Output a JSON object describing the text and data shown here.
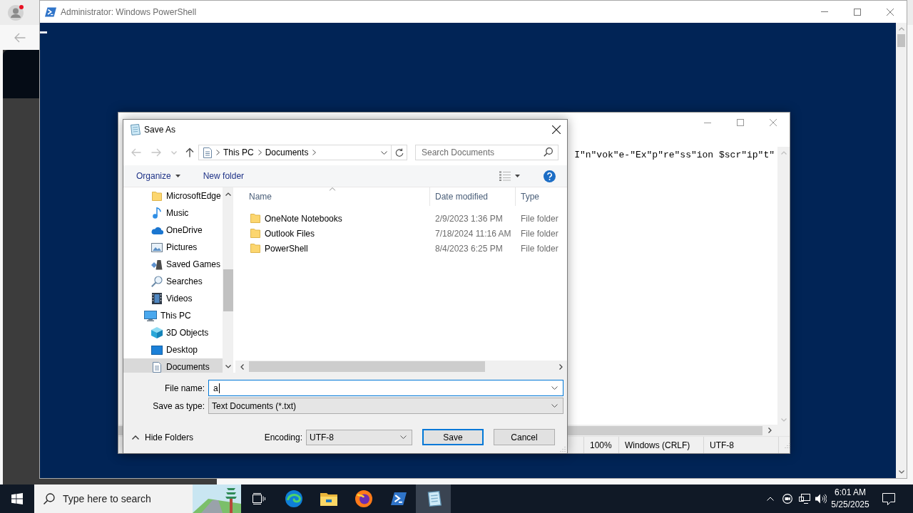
{
  "powershell_window": {
    "title": "Administrator: Windows PowerShell"
  },
  "notepad_window": {
    "text": "I\"n\"vok\"e-\"Ex\"p\"re\"ss\"ion $scr\"ip\"t\"",
    "status_bar": [
      "100%",
      "Windows (CRLF)",
      "UTF-8"
    ]
  },
  "save_as_dialog": {
    "title": "Save As",
    "nav_buttons": [
      {
        "disabled": true
      },
      {
        "disabled": true
      },
      {
        "disabled": true
      },
      {
        "disabled": false
      }
    ],
    "address_path": [
      "This PC",
      "Documents"
    ],
    "search": {
      "placeholder": "Search Documents"
    },
    "toolbar": [
      {
        "label": "Organize",
        "kind": "menu"
      },
      {
        "label": "New folder",
        "kind": "button"
      }
    ],
    "nav_tree": [
      {
        "children": [
          {
            "label": "MicrosoftEdge",
            "selected": false
          },
          {
            "label": "Music",
            "selected": false
          },
          {
            "label": "OneDrive",
            "selected": false
          },
          {
            "label": "Pictures",
            "selected": false
          },
          {
            "label": "Saved Games",
            "selected": false
          },
          {
            "label": "Searches",
            "selected": false
          },
          {
            "label": "Videos",
            "selected": false
          }
        ]
      },
      {
        "label": "This PC",
        "selected": false,
        "children": [
          {
            "label": "3D Objects",
            "selected": false
          },
          {
            "label": "Desktop",
            "selected": false
          },
          {
            "label": "Documents",
            "selected": true
          }
        ]
      }
    ],
    "file_list": {
      "columns": [
        {
          "label": "Name",
          "sorted": true
        },
        {
          "label": "Date modified",
          "sorted": false
        },
        {
          "label": "Type",
          "sorted": false
        }
      ],
      "rows": [
        {
          "name": "OneNote Notebooks",
          "date_modified": "2/9/2023 1:36 PM",
          "type": "File folder"
        },
        {
          "name": "Outlook Files",
          "date_modified": "7/18/2024 11:16 AM",
          "type": "File folder"
        },
        {
          "name": "PowerShell",
          "date_modified": "8/4/2023 6:25 PM",
          "type": "File folder"
        }
      ]
    },
    "file_name": {
      "label": "File name:",
      "value": "a"
    },
    "save_as_type": {
      "label": "Save as type:",
      "value": "Text Documents (*.txt)"
    },
    "hide_folders": "Hide Folders",
    "encoding": {
      "label": "Encoding:",
      "value": "UTF-8"
    },
    "buttons": [
      {
        "label": "Save",
        "default": true
      },
      {
        "label": "Cancel",
        "default": false
      }
    ]
  },
  "taskbar": {
    "search": {
      "placeholder": "Type here to search"
    },
    "apps": [
      {
        "selected": false
      },
      {
        "selected": false
      },
      {
        "selected": false
      },
      {
        "selected": false
      },
      {
        "selected": false
      },
      {
        "selected": true
      }
    ],
    "clock": {
      "time": "6:01 AM",
      "date": "5/25/2025"
    }
  }
}
